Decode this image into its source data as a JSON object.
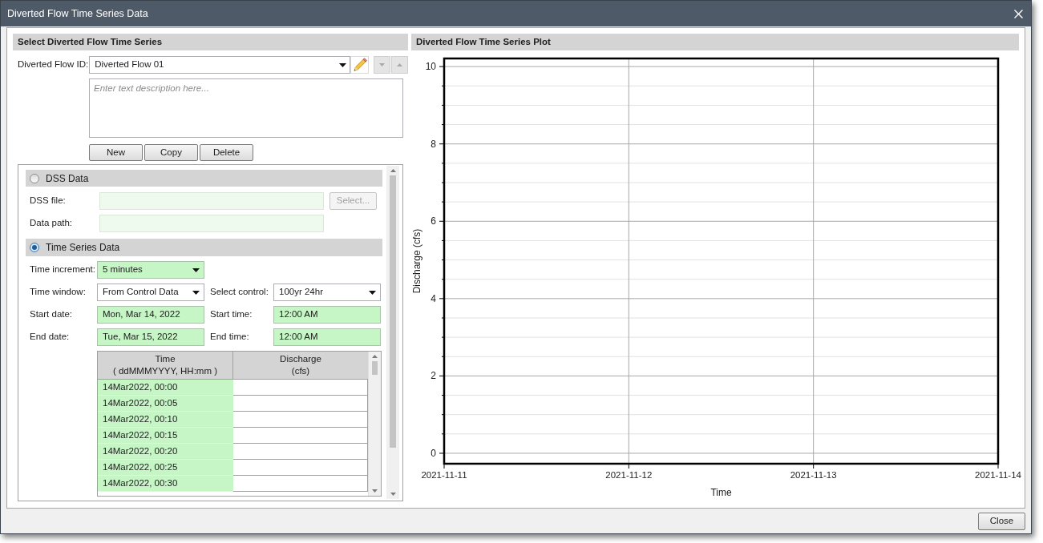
{
  "window": {
    "title": "Diverted Flow Time Series Data"
  },
  "select_panel": {
    "title": "Select Diverted Flow Time Series",
    "flow_id": {
      "label": "Diverted Flow ID:",
      "value": "Diverted Flow 01"
    },
    "order_buttons": [
      {
        "kind": "down",
        "disabled": true
      },
      {
        "kind": "up",
        "disabled": true
      }
    ],
    "description": {
      "placeholder": "Enter text description here..."
    },
    "buttons": [
      "New",
      "Copy",
      "Delete"
    ],
    "sources": [
      {
        "kind": "dss",
        "label": "DSS Data",
        "selected": false,
        "fields": [
          {
            "label": "DSS file:",
            "highlighted": true,
            "disabled": true
          },
          {
            "label": "Data path:",
            "highlighted": true,
            "disabled": true
          }
        ],
        "select_button": {
          "label": "Select...",
          "disabled": true
        }
      },
      {
        "kind": "time_series",
        "label": "Time Series Data",
        "selected": true,
        "rows": [
          [
            {
              "label": "Time increment:",
              "value": "5 minutes",
              "kind": "dropdown",
              "highlighted": true
            }
          ],
          [
            {
              "label": "Time window:",
              "value": "From Control Data",
              "kind": "dropdown",
              "highlighted": false
            },
            {
              "label": "Select control:",
              "value": "100yr 24hr",
              "kind": "dropdown",
              "highlighted": false
            }
          ],
          [
            {
              "label": "Start date:",
              "value": "Mon, Mar 14, 2022",
              "kind": "text",
              "highlighted": true
            },
            {
              "label": "Start time:",
              "value": "12:00 AM",
              "kind": "text",
              "highlighted": true
            }
          ],
          [
            {
              "label": "End date:",
              "value": "Tue, Mar 15, 2022",
              "kind": "text",
              "highlighted": true
            },
            {
              "label": "End time:",
              "value": "12:00 AM",
              "kind": "text",
              "highlighted": true
            }
          ]
        ],
        "table": {
          "columns": [
            {
              "title": "Time",
              "unit": "( ddMMMYYYY, HH:mm )"
            },
            {
              "title": "Discharge",
              "unit": "(cfs)"
            }
          ],
          "rows": [
            {
              "time": "14Mar2022, 00:00"
            },
            {
              "time": "14Mar2022, 00:05"
            },
            {
              "time": "14Mar2022, 00:10"
            },
            {
              "time": "14Mar2022, 00:15"
            },
            {
              "time": "14Mar2022, 00:20"
            },
            {
              "time": "14Mar2022, 00:25"
            },
            {
              "time": "14Mar2022, 00:30"
            }
          ]
        }
      }
    ]
  },
  "plot_panel": {
    "title": "Diverted Flow Time Series Plot",
    "chart_data": {
      "type": "line",
      "xlabel": "Time",
      "ylabel": "Discharge (cfs)",
      "categories": [
        "2021-11-11",
        "2021-11-12",
        "2021-11-13",
        "2021-11-14"
      ],
      "ylim": [
        -0.27,
        10.21
      ],
      "yticks": [
        0,
        2,
        4,
        6,
        8,
        10
      ],
      "grid": true
    }
  },
  "close_button": "Close"
}
